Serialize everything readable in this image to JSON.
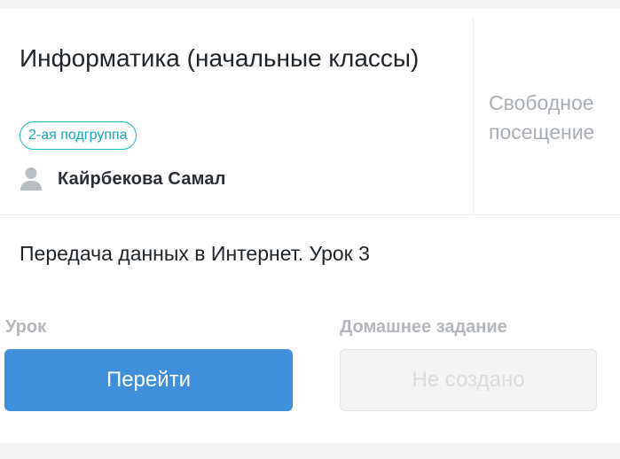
{
  "lesson": {
    "subject": "Информатика (начальные классы)",
    "group_badge": "2-ая подгруппа",
    "teacher": "Кайрбекова Самал",
    "attendance": "Свободное посещение",
    "topic": "Передача данных в Интернет. Урок 3"
  },
  "lesson_section": {
    "label": "Урок",
    "button": "Перейти"
  },
  "homework_section": {
    "label": "Домашнее задание",
    "button": "Не создано"
  },
  "colors": {
    "primary_button": "#3f8fdb",
    "badge_accent": "#16b3c4"
  },
  "icons": {
    "teacher": "user-icon"
  }
}
